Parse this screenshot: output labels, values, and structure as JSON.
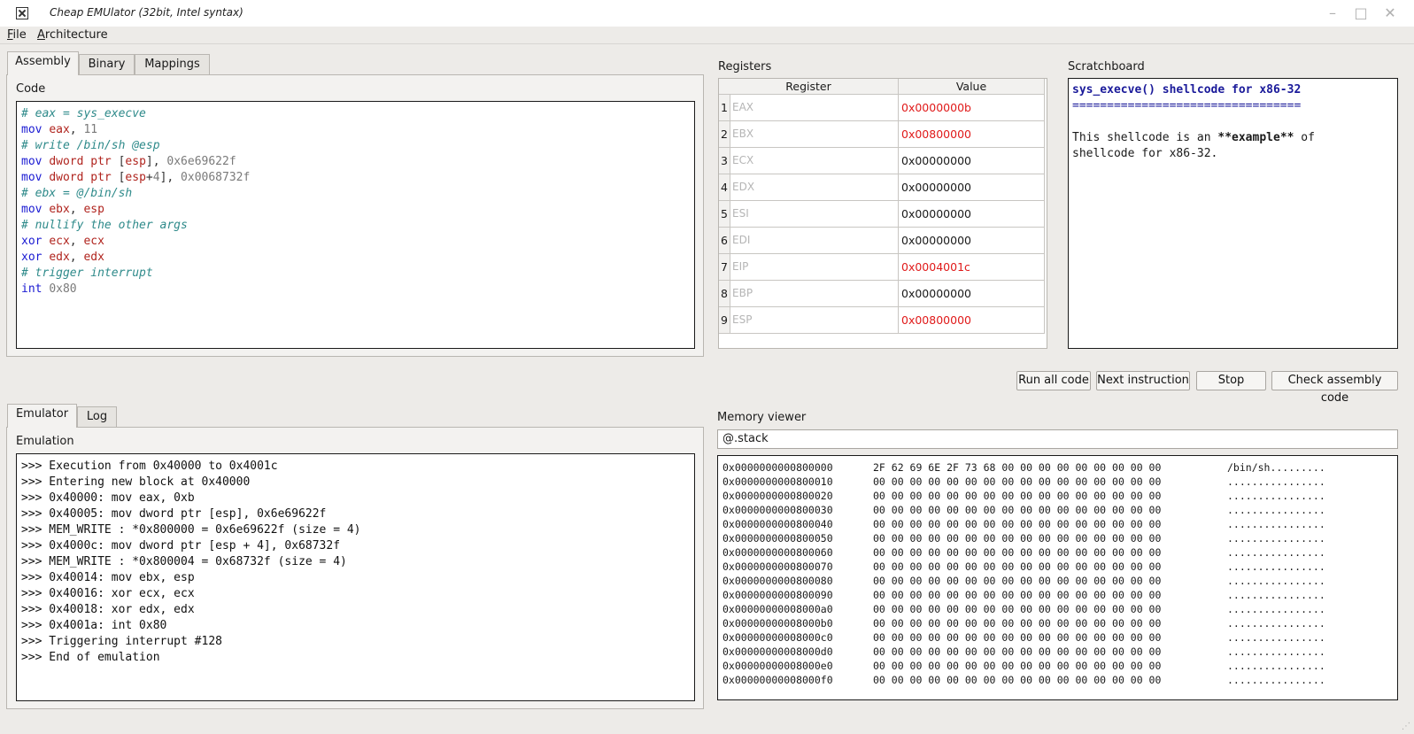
{
  "window": {
    "title": "Cheap EMUlator (32bit, Intel syntax)",
    "icon": "app-icon",
    "minimize": "–",
    "maximize": "□",
    "close": "✕"
  },
  "menu": [
    {
      "label": "File",
      "underline": "F",
      "rest": "ile"
    },
    {
      "label": "Architecture",
      "underline": "A",
      "rest": "rchitecture"
    }
  ],
  "top_tabs": [
    "Assembly",
    "Binary",
    "Mappings"
  ],
  "top_active_tab": "Assembly",
  "code": {
    "label": "Code",
    "lines": [
      [
        [
          "c",
          "# eax = sys_execve"
        ]
      ],
      [
        [
          "k",
          "mov"
        ],
        [
          "p",
          " "
        ],
        [
          "r",
          "eax"
        ],
        [
          "p",
          ", "
        ],
        [
          "n",
          "11"
        ]
      ],
      [
        [
          "c",
          "# write /bin/sh @esp"
        ]
      ],
      [
        [
          "k",
          "mov"
        ],
        [
          "p",
          " "
        ],
        [
          "r",
          "dword"
        ],
        [
          "p",
          " "
        ],
        [
          "r",
          "ptr"
        ],
        [
          "p",
          " ["
        ],
        [
          "r",
          "esp"
        ],
        [
          "p",
          "], "
        ],
        [
          "n",
          "0x6e69622f"
        ]
      ],
      [
        [
          "k",
          "mov"
        ],
        [
          "p",
          " "
        ],
        [
          "r",
          "dword"
        ],
        [
          "p",
          " "
        ],
        [
          "r",
          "ptr"
        ],
        [
          "p",
          " ["
        ],
        [
          "r",
          "esp"
        ],
        [
          "p",
          "+"
        ],
        [
          "n",
          "4"
        ],
        [
          "p",
          "], "
        ],
        [
          "n",
          "0x0068732f"
        ]
      ],
      [
        [
          "c",
          "# ebx = @/bin/sh"
        ]
      ],
      [
        [
          "k",
          "mov"
        ],
        [
          "p",
          " "
        ],
        [
          "r",
          "ebx"
        ],
        [
          "p",
          ", "
        ],
        [
          "r",
          "esp"
        ]
      ],
      [
        [
          "c",
          "# nullify the other args"
        ]
      ],
      [
        [
          "k",
          "xor"
        ],
        [
          "p",
          " "
        ],
        [
          "r",
          "ecx"
        ],
        [
          "p",
          ", "
        ],
        [
          "r",
          "ecx"
        ]
      ],
      [
        [
          "k",
          "xor"
        ],
        [
          "p",
          " "
        ],
        [
          "r",
          "edx"
        ],
        [
          "p",
          ", "
        ],
        [
          "r",
          "edx"
        ]
      ],
      [
        [
          "c",
          "# trigger interrupt"
        ]
      ],
      [
        [
          "k",
          "int"
        ],
        [
          "p",
          " "
        ],
        [
          "n",
          "0x80"
        ]
      ]
    ]
  },
  "registers": {
    "label": "Registers",
    "columns": [
      "Register",
      "Value"
    ],
    "rows": [
      {
        "index": "1",
        "name": "EAX",
        "value": "0x0000000b",
        "changed": true
      },
      {
        "index": "2",
        "name": "EBX",
        "value": "0x00800000",
        "changed": true
      },
      {
        "index": "3",
        "name": "ECX",
        "value": "0x00000000",
        "changed": false
      },
      {
        "index": "4",
        "name": "EDX",
        "value": "0x00000000",
        "changed": false
      },
      {
        "index": "5",
        "name": "ESI",
        "value": "0x00000000",
        "changed": false
      },
      {
        "index": "6",
        "name": "EDI",
        "value": "0x00000000",
        "changed": false
      },
      {
        "index": "7",
        "name": "EIP",
        "value": "0x0004001c",
        "changed": true
      },
      {
        "index": "8",
        "name": "EBP",
        "value": "0x00000000",
        "changed": false
      },
      {
        "index": "9",
        "name": "ESP",
        "value": "0x00800000",
        "changed": true
      }
    ]
  },
  "scratchboard": {
    "label": "Scratchboard",
    "heading": "sys_execve() shellcode for x86-32",
    "rule": "=================================",
    "body_before": "This shellcode is an ",
    "body_bold": "**example**",
    "body_after": " of\nshellcode for x86-32."
  },
  "actions": {
    "run_all": "Run all code",
    "next": "Next instruction",
    "stop": "Stop",
    "check": "Check assembly code"
  },
  "bottom_tabs": [
    "Emulator",
    "Log"
  ],
  "bottom_active_tab": "Emulator",
  "emulation": {
    "label": "Emulation",
    "lines": [
      ">>> Execution from 0x40000 to 0x4001c",
      ">>> Entering new block at 0x40000",
      ">>> 0x40000: mov eax, 0xb",
      ">>> 0x40005: mov dword ptr [esp], 0x6e69622f",
      ">>> MEM_WRITE : *0x800000 = 0x6e69622f (size = 4)",
      ">>> 0x4000c: mov dword ptr [esp + 4], 0x68732f",
      ">>> MEM_WRITE : *0x800004 = 0x68732f (size = 4)",
      ">>> 0x40014: mov ebx, esp",
      ">>> 0x40016: xor ecx, ecx",
      ">>> 0x40018: xor edx, edx",
      ">>> 0x4001a: int 0x80",
      ">>> Triggering interrupt #128",
      ">>> End of emulation"
    ]
  },
  "memory": {
    "label": "Memory viewer",
    "address_input": "@.stack",
    "rows": [
      {
        "addr": "0x0000000000800000",
        "hex": "2F 62 69 6E 2F 73 68 00 00 00 00 00 00 00 00 00",
        "ascii": "/bin/sh........."
      },
      {
        "addr": "0x0000000000800010",
        "hex": "00 00 00 00 00 00 00 00 00 00 00 00 00 00 00 00",
        "ascii": "................"
      },
      {
        "addr": "0x0000000000800020",
        "hex": "00 00 00 00 00 00 00 00 00 00 00 00 00 00 00 00",
        "ascii": "................"
      },
      {
        "addr": "0x0000000000800030",
        "hex": "00 00 00 00 00 00 00 00 00 00 00 00 00 00 00 00",
        "ascii": "................"
      },
      {
        "addr": "0x0000000000800040",
        "hex": "00 00 00 00 00 00 00 00 00 00 00 00 00 00 00 00",
        "ascii": "................"
      },
      {
        "addr": "0x0000000000800050",
        "hex": "00 00 00 00 00 00 00 00 00 00 00 00 00 00 00 00",
        "ascii": "................"
      },
      {
        "addr": "0x0000000000800060",
        "hex": "00 00 00 00 00 00 00 00 00 00 00 00 00 00 00 00",
        "ascii": "................"
      },
      {
        "addr": "0x0000000000800070",
        "hex": "00 00 00 00 00 00 00 00 00 00 00 00 00 00 00 00",
        "ascii": "................"
      },
      {
        "addr": "0x0000000000800080",
        "hex": "00 00 00 00 00 00 00 00 00 00 00 00 00 00 00 00",
        "ascii": "................"
      },
      {
        "addr": "0x0000000000800090",
        "hex": "00 00 00 00 00 00 00 00 00 00 00 00 00 00 00 00",
        "ascii": "................"
      },
      {
        "addr": "0x00000000008000a0",
        "hex": "00 00 00 00 00 00 00 00 00 00 00 00 00 00 00 00",
        "ascii": "................"
      },
      {
        "addr": "0x00000000008000b0",
        "hex": "00 00 00 00 00 00 00 00 00 00 00 00 00 00 00 00",
        "ascii": "................"
      },
      {
        "addr": "0x00000000008000c0",
        "hex": "00 00 00 00 00 00 00 00 00 00 00 00 00 00 00 00",
        "ascii": "................"
      },
      {
        "addr": "0x00000000008000d0",
        "hex": "00 00 00 00 00 00 00 00 00 00 00 00 00 00 00 00",
        "ascii": "................"
      },
      {
        "addr": "0x00000000008000e0",
        "hex": "00 00 00 00 00 00 00 00 00 00 00 00 00 00 00 00",
        "ascii": "................"
      },
      {
        "addr": "0x00000000008000f0",
        "hex": "00 00 00 00 00 00 00 00 00 00 00 00 00 00 00 00",
        "ascii": "................"
      }
    ]
  }
}
